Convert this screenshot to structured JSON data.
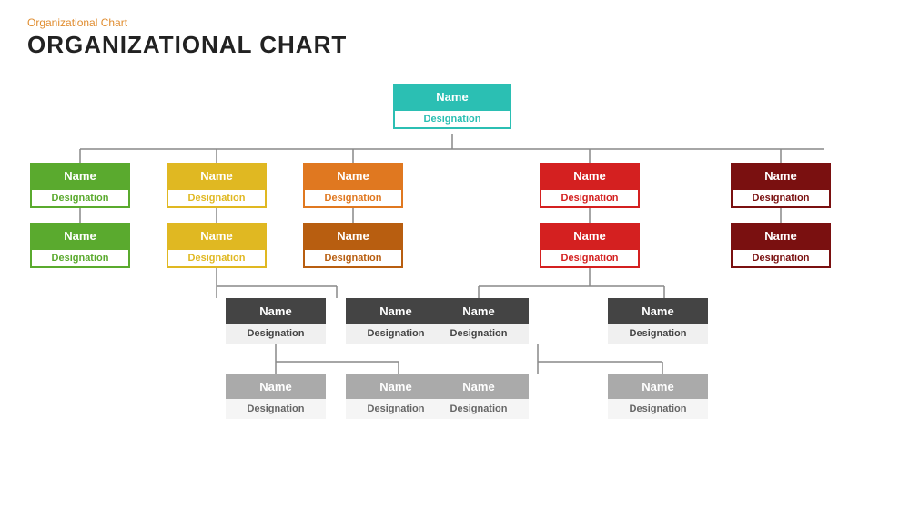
{
  "header": {
    "subtitle": "Organizational Chart",
    "title": "ORGANIZATIONAL CHART"
  },
  "nodes": {
    "root": {
      "name": "Name",
      "designation": "Designation"
    },
    "l2": {
      "green": {
        "name": "Name",
        "designation": "Designation"
      },
      "yellow": {
        "name": "Name",
        "designation": "Designation"
      },
      "orange": {
        "name": "Name",
        "designation": "Designation"
      },
      "red": {
        "name": "Name",
        "designation": "Designation"
      },
      "darkred": {
        "name": "Name",
        "designation": "Designation"
      }
    },
    "l2b": {
      "green": {
        "name": "Name",
        "designation": "Designation"
      },
      "yellow": {
        "name": "Name",
        "designation": "Designation"
      },
      "darkorange": {
        "name": "Name",
        "designation": "Designation"
      },
      "red": {
        "name": "Name",
        "designation": "Designation"
      },
      "darkred": {
        "name": "Name",
        "designation": "Designation"
      }
    },
    "l3": {
      "left1": {
        "name": "Name",
        "designation": "Designation"
      },
      "left2": {
        "name": "Name",
        "designation": "Designation"
      },
      "right1": {
        "name": "Name",
        "designation": "Designation"
      },
      "right2": {
        "name": "Name",
        "designation": "Designation"
      }
    },
    "l4": {
      "left1": {
        "name": "Name",
        "designation": "Designation"
      },
      "left2": {
        "name": "Name",
        "designation": "Designation"
      },
      "right1": {
        "name": "Name",
        "designation": "Designation"
      },
      "right2": {
        "name": "Name",
        "designation": "Designation"
      }
    }
  }
}
